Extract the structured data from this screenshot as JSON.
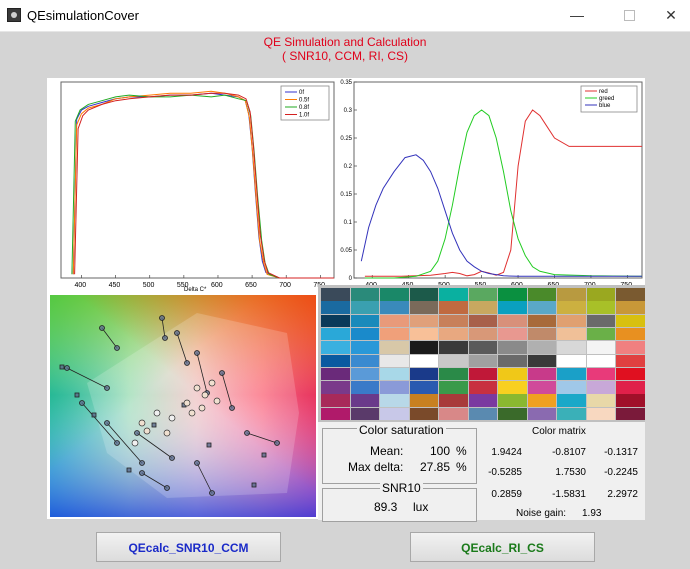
{
  "window": {
    "title": "QEsimulationCover",
    "minimize_icon": "minimize-icon",
    "maximize_icon": "maximize-icon",
    "close_icon": "close-icon"
  },
  "heading": {
    "line1": "QE Simulation and Calculation",
    "line2": "( SNR10, CCM, RI, CS)",
    "color": "#e0001a"
  },
  "qe_chart": {
    "chart_data": {
      "type": "line",
      "xlabel": "Delta C*",
      "ylabel": "",
      "xlim": [
        370,
        770
      ],
      "x_ticks": [
        "400",
        "450",
        "500",
        "550",
        "600",
        "650",
        "700",
        "750"
      ],
      "legend": {
        "placement": "top-right",
        "entries": [
          "0f",
          "0.5f",
          "0.8f",
          "1.0f"
        ]
      },
      "series": [
        {
          "name": "0f",
          "color": "#3333cc",
          "x": [
            388,
            393,
            400,
            410,
            430,
            450,
            470,
            500,
            530,
            560,
            590,
            610,
            630,
            640,
            645,
            650,
            655,
            660,
            665,
            670,
            690,
            720,
            770
          ],
          "y": [
            0.02,
            0.85,
            0.9,
            0.92,
            0.94,
            0.96,
            0.97,
            0.97,
            0.98,
            0.98,
            0.99,
            0.98,
            0.97,
            0.95,
            0.88,
            0.7,
            0.45,
            0.22,
            0.09,
            0.03,
            0.0,
            0.0,
            0.0
          ]
        },
        {
          "name": "0.5f",
          "color": "#ff7a00",
          "x": [
            388,
            393,
            400,
            410,
            430,
            450,
            470,
            500,
            530,
            560,
            590,
            610,
            630,
            640,
            646,
            651,
            656,
            661,
            667,
            672,
            690,
            720,
            770
          ],
          "y": [
            0.02,
            0.82,
            0.88,
            0.91,
            0.93,
            0.96,
            0.97,
            0.98,
            0.99,
            0.99,
            1.0,
            0.99,
            0.97,
            0.95,
            0.86,
            0.66,
            0.42,
            0.2,
            0.08,
            0.02,
            0.0,
            0.0,
            0.0
          ]
        },
        {
          "name": "0.8f",
          "color": "#22aa22",
          "x": [
            386,
            391,
            398,
            410,
            430,
            450,
            470,
            500,
            530,
            560,
            590,
            610,
            630,
            642,
            648,
            653,
            658,
            664,
            669,
            675,
            690,
            720,
            770
          ],
          "y": [
            0.02,
            0.84,
            0.9,
            0.93,
            0.95,
            0.97,
            0.98,
            0.97,
            0.97,
            0.98,
            0.97,
            0.98,
            0.96,
            0.95,
            0.87,
            0.68,
            0.44,
            0.2,
            0.08,
            0.02,
            0.0,
            0.0,
            0.0
          ]
        },
        {
          "name": "1.0f",
          "color": "#d42020",
          "x": [
            390,
            395,
            402,
            410,
            430,
            450,
            470,
            500,
            530,
            560,
            590,
            610,
            630,
            641,
            647,
            652,
            657,
            662,
            668,
            673,
            690,
            720,
            770
          ],
          "y": [
            0.02,
            0.8,
            0.87,
            0.9,
            0.93,
            0.95,
            0.96,
            0.97,
            0.98,
            0.98,
            0.99,
            0.99,
            0.98,
            0.96,
            0.89,
            0.7,
            0.46,
            0.23,
            0.09,
            0.03,
            0.0,
            0.0,
            0.0
          ]
        }
      ]
    }
  },
  "rgb_chart": {
    "chart_data": {
      "type": "line",
      "xlabel": "",
      "ylabel": "",
      "xlim": [
        375,
        770
      ],
      "ylim": [
        0,
        0.35
      ],
      "x_ticks": [
        "400",
        "450",
        "500",
        "550",
        "600",
        "650",
        "700",
        "750"
      ],
      "y_ticks": [
        "0",
        "0.05",
        "0.1",
        "0.15",
        "0.2",
        "0.25",
        "0.3",
        "0.35"
      ],
      "legend": {
        "placement": "top-right",
        "entries": [
          "red",
          "greed",
          "blue"
        ]
      },
      "series": [
        {
          "name": "red",
          "color": "#e03030",
          "x": [
            390,
            440,
            480,
            500,
            510,
            520,
            530,
            540,
            550,
            560,
            570,
            580,
            590,
            600,
            610,
            620,
            630,
            640,
            650,
            670,
            700,
            770
          ],
          "y": [
            0.003,
            0.003,
            0.005,
            0.008,
            0.01,
            0.008,
            0.004,
            0.006,
            0.012,
            0.009,
            0.005,
            0.01,
            0.05,
            0.2,
            0.28,
            0.3,
            0.29,
            0.27,
            0.25,
            0.235,
            0.235,
            0.235
          ]
        },
        {
          "name": "greed",
          "color": "#22cc22",
          "x": [
            390,
            430,
            460,
            480,
            490,
            500,
            510,
            520,
            530,
            540,
            550,
            560,
            570,
            580,
            590,
            600,
            610,
            620,
            630,
            650,
            700,
            770
          ],
          "y": [
            0.0,
            0.0,
            0.003,
            0.012,
            0.03,
            0.07,
            0.13,
            0.2,
            0.26,
            0.29,
            0.3,
            0.29,
            0.25,
            0.19,
            0.12,
            0.07,
            0.04,
            0.02,
            0.012,
            0.006,
            0.004,
            0.003
          ]
        },
        {
          "name": "blue",
          "color": "#3333bb",
          "x": [
            385,
            395,
            405,
            415,
            430,
            445,
            460,
            470,
            480,
            490,
            500,
            510,
            520,
            530,
            540,
            550,
            560,
            580,
            600,
            650,
            700,
            770
          ],
          "y": [
            0.03,
            0.09,
            0.13,
            0.16,
            0.19,
            0.215,
            0.22,
            0.21,
            0.19,
            0.16,
            0.12,
            0.08,
            0.05,
            0.03,
            0.02,
            0.012,
            0.008,
            0.004,
            0.003,
            0.003,
            0.003,
            0.003
          ]
        }
      ]
    }
  },
  "color_patches": {
    "rows": [
      [
        "#3a4a5a",
        "#2a8a7a",
        "#1a8868",
        "#1c5a4a",
        "#0ab0a0",
        "#5aa860",
        "#0a9040",
        "#4a8a2a",
        "#b89a40",
        "#9aa820",
        "#7a5a30"
      ],
      [
        "#1a6aa0",
        "#3aa0b0",
        "#3a8abb",
        "#7a6a5a",
        "#c06a40",
        "#c8a860",
        "#0aa0c0",
        "#5aa8c8",
        "#ccb040",
        "#a8c028",
        "#c89838"
      ],
      [
        "#0a3a5a",
        "#1a8abb",
        "#e89a7a",
        "#e0a07a",
        "#c8805a",
        "#a8604a",
        "#d8907a",
        "#a86a3a",
        "#e0a070",
        "#6a6a6a",
        "#d8c010"
      ],
      [
        "#2aa8d8",
        "#1a8acb",
        "#f0a07a",
        "#f8c098",
        "#e8a880",
        "#d89878",
        "#e89890",
        "#c08a6a",
        "#f0c098",
        "#6ab048",
        "#e89020"
      ],
      [
        "#3ab0e0",
        "#2a98d8",
        "#d8c8a8",
        "#1a1a1a",
        "#3a3a3a",
        "#5a5a5a",
        "#8a8a8a",
        "#b0b0b0",
        "#d8d8d8",
        "#f4f4f4",
        "#f08080"
      ],
      [
        "#0a5aa0",
        "#3a8ad0",
        "#e8e8e8",
        "#ffffff",
        "#c8c8c8",
        "#a0a0a0",
        "#6a6a6a",
        "#3a3a3a",
        "#ffffff",
        "#ffffff",
        "#e04040"
      ],
      [
        "#6a2a7a",
        "#5a9ad8",
        "#a8d8e8",
        "#1a3a8a",
        "#2a8a48",
        "#c01838",
        "#f0c818",
        "#c83a8a",
        "#1aa0c8",
        "#e83a7a",
        "#e01020"
      ],
      [
        "#7a3a8a",
        "#3a7ac8",
        "#8a9ad8",
        "#2a5ab0",
        "#3a9a4a",
        "#c83040",
        "#f8d020",
        "#d04a9a",
        "#a0c8e8",
        "#c8a8d8",
        "#e0204a"
      ],
      [
        "#a82a5a",
        "#6a3a8a",
        "#b8d8e8",
        "#c88020",
        "#a83a3a",
        "#7a3aa0",
        "#8ab830",
        "#f0a020",
        "#1aa8c8",
        "#e8d8a8",
        "#a0102a"
      ],
      [
        "#b01a6a",
        "#5a3a6a",
        "#c8c8e8",
        "#7a4a2a",
        "#d88888",
        "#5a8ab0",
        "#3a6a2a",
        "#8a6ab0",
        "#3ab0b8",
        "#f8d8c0",
        "#7a1a3a"
      ]
    ]
  },
  "color_saturation": {
    "title": "Color saturation",
    "mean_label": "Mean:",
    "mean_value": "100",
    "mean_unit": "%",
    "maxdelta_label": "Max delta:",
    "maxdelta_value": "27.85",
    "maxdelta_unit": "%"
  },
  "snr10": {
    "title": "SNR10",
    "value": "89.3",
    "unit": "lux"
  },
  "color_matrix": {
    "title": "Color matrix",
    "rows": [
      [
        "1.9424",
        "-0.8107",
        "-0.1317"
      ],
      [
        "-0.5285",
        "1.7530",
        "-0.2245"
      ],
      [
        "0.2859",
        "-1.5831",
        "2.2972"
      ]
    ],
    "noise_label": "Noise gain:",
    "noise_value": "1.93"
  },
  "buttons": {
    "snr_ccm": {
      "label": "QEcalc_SNR10_CCM",
      "color": "#1a2ac8"
    },
    "ri_cs": {
      "label": "QEcalc_RI_CS",
      "color": "#1a7a1a"
    }
  }
}
